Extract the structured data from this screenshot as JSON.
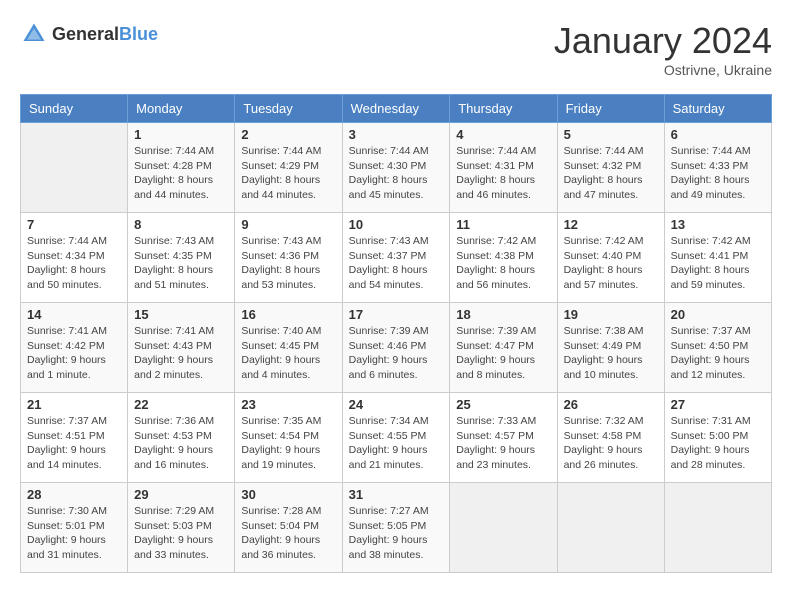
{
  "logo": {
    "text_general": "General",
    "text_blue": "Blue"
  },
  "title": {
    "month": "January 2024",
    "location": "Ostrivne, Ukraine"
  },
  "weekdays": [
    "Sunday",
    "Monday",
    "Tuesday",
    "Wednesday",
    "Thursday",
    "Friday",
    "Saturday"
  ],
  "weeks": [
    [
      {
        "day": "",
        "sunrise": "",
        "sunset": "",
        "daylight": ""
      },
      {
        "day": "1",
        "sunrise": "Sunrise: 7:44 AM",
        "sunset": "Sunset: 4:28 PM",
        "daylight": "Daylight: 8 hours and 44 minutes."
      },
      {
        "day": "2",
        "sunrise": "Sunrise: 7:44 AM",
        "sunset": "Sunset: 4:29 PM",
        "daylight": "Daylight: 8 hours and 44 minutes."
      },
      {
        "day": "3",
        "sunrise": "Sunrise: 7:44 AM",
        "sunset": "Sunset: 4:30 PM",
        "daylight": "Daylight: 8 hours and 45 minutes."
      },
      {
        "day": "4",
        "sunrise": "Sunrise: 7:44 AM",
        "sunset": "Sunset: 4:31 PM",
        "daylight": "Daylight: 8 hours and 46 minutes."
      },
      {
        "day": "5",
        "sunrise": "Sunrise: 7:44 AM",
        "sunset": "Sunset: 4:32 PM",
        "daylight": "Daylight: 8 hours and 47 minutes."
      },
      {
        "day": "6",
        "sunrise": "Sunrise: 7:44 AM",
        "sunset": "Sunset: 4:33 PM",
        "daylight": "Daylight: 8 hours and 49 minutes."
      }
    ],
    [
      {
        "day": "7",
        "sunrise": "Sunrise: 7:44 AM",
        "sunset": "Sunset: 4:34 PM",
        "daylight": "Daylight: 8 hours and 50 minutes."
      },
      {
        "day": "8",
        "sunrise": "Sunrise: 7:43 AM",
        "sunset": "Sunset: 4:35 PM",
        "daylight": "Daylight: 8 hours and 51 minutes."
      },
      {
        "day": "9",
        "sunrise": "Sunrise: 7:43 AM",
        "sunset": "Sunset: 4:36 PM",
        "daylight": "Daylight: 8 hours and 53 minutes."
      },
      {
        "day": "10",
        "sunrise": "Sunrise: 7:43 AM",
        "sunset": "Sunset: 4:37 PM",
        "daylight": "Daylight: 8 hours and 54 minutes."
      },
      {
        "day": "11",
        "sunrise": "Sunrise: 7:42 AM",
        "sunset": "Sunset: 4:38 PM",
        "daylight": "Daylight: 8 hours and 56 minutes."
      },
      {
        "day": "12",
        "sunrise": "Sunrise: 7:42 AM",
        "sunset": "Sunset: 4:40 PM",
        "daylight": "Daylight: 8 hours and 57 minutes."
      },
      {
        "day": "13",
        "sunrise": "Sunrise: 7:42 AM",
        "sunset": "Sunset: 4:41 PM",
        "daylight": "Daylight: 8 hours and 59 minutes."
      }
    ],
    [
      {
        "day": "14",
        "sunrise": "Sunrise: 7:41 AM",
        "sunset": "Sunset: 4:42 PM",
        "daylight": "Daylight: 9 hours and 1 minute."
      },
      {
        "day": "15",
        "sunrise": "Sunrise: 7:41 AM",
        "sunset": "Sunset: 4:43 PM",
        "daylight": "Daylight: 9 hours and 2 minutes."
      },
      {
        "day": "16",
        "sunrise": "Sunrise: 7:40 AM",
        "sunset": "Sunset: 4:45 PM",
        "daylight": "Daylight: 9 hours and 4 minutes."
      },
      {
        "day": "17",
        "sunrise": "Sunrise: 7:39 AM",
        "sunset": "Sunset: 4:46 PM",
        "daylight": "Daylight: 9 hours and 6 minutes."
      },
      {
        "day": "18",
        "sunrise": "Sunrise: 7:39 AM",
        "sunset": "Sunset: 4:47 PM",
        "daylight": "Daylight: 9 hours and 8 minutes."
      },
      {
        "day": "19",
        "sunrise": "Sunrise: 7:38 AM",
        "sunset": "Sunset: 4:49 PM",
        "daylight": "Daylight: 9 hours and 10 minutes."
      },
      {
        "day": "20",
        "sunrise": "Sunrise: 7:37 AM",
        "sunset": "Sunset: 4:50 PM",
        "daylight": "Daylight: 9 hours and 12 minutes."
      }
    ],
    [
      {
        "day": "21",
        "sunrise": "Sunrise: 7:37 AM",
        "sunset": "Sunset: 4:51 PM",
        "daylight": "Daylight: 9 hours and 14 minutes."
      },
      {
        "day": "22",
        "sunrise": "Sunrise: 7:36 AM",
        "sunset": "Sunset: 4:53 PM",
        "daylight": "Daylight: 9 hours and 16 minutes."
      },
      {
        "day": "23",
        "sunrise": "Sunrise: 7:35 AM",
        "sunset": "Sunset: 4:54 PM",
        "daylight": "Daylight: 9 hours and 19 minutes."
      },
      {
        "day": "24",
        "sunrise": "Sunrise: 7:34 AM",
        "sunset": "Sunset: 4:55 PM",
        "daylight": "Daylight: 9 hours and 21 minutes."
      },
      {
        "day": "25",
        "sunrise": "Sunrise: 7:33 AM",
        "sunset": "Sunset: 4:57 PM",
        "daylight": "Daylight: 9 hours and 23 minutes."
      },
      {
        "day": "26",
        "sunrise": "Sunrise: 7:32 AM",
        "sunset": "Sunset: 4:58 PM",
        "daylight": "Daylight: 9 hours and 26 minutes."
      },
      {
        "day": "27",
        "sunrise": "Sunrise: 7:31 AM",
        "sunset": "Sunset: 5:00 PM",
        "daylight": "Daylight: 9 hours and 28 minutes."
      }
    ],
    [
      {
        "day": "28",
        "sunrise": "Sunrise: 7:30 AM",
        "sunset": "Sunset: 5:01 PM",
        "daylight": "Daylight: 9 hours and 31 minutes."
      },
      {
        "day": "29",
        "sunrise": "Sunrise: 7:29 AM",
        "sunset": "Sunset: 5:03 PM",
        "daylight": "Daylight: 9 hours and 33 minutes."
      },
      {
        "day": "30",
        "sunrise": "Sunrise: 7:28 AM",
        "sunset": "Sunset: 5:04 PM",
        "daylight": "Daylight: 9 hours and 36 minutes."
      },
      {
        "day": "31",
        "sunrise": "Sunrise: 7:27 AM",
        "sunset": "Sunset: 5:05 PM",
        "daylight": "Daylight: 9 hours and 38 minutes."
      },
      {
        "day": "",
        "sunrise": "",
        "sunset": "",
        "daylight": ""
      },
      {
        "day": "",
        "sunrise": "",
        "sunset": "",
        "daylight": ""
      },
      {
        "day": "",
        "sunrise": "",
        "sunset": "",
        "daylight": ""
      }
    ]
  ]
}
